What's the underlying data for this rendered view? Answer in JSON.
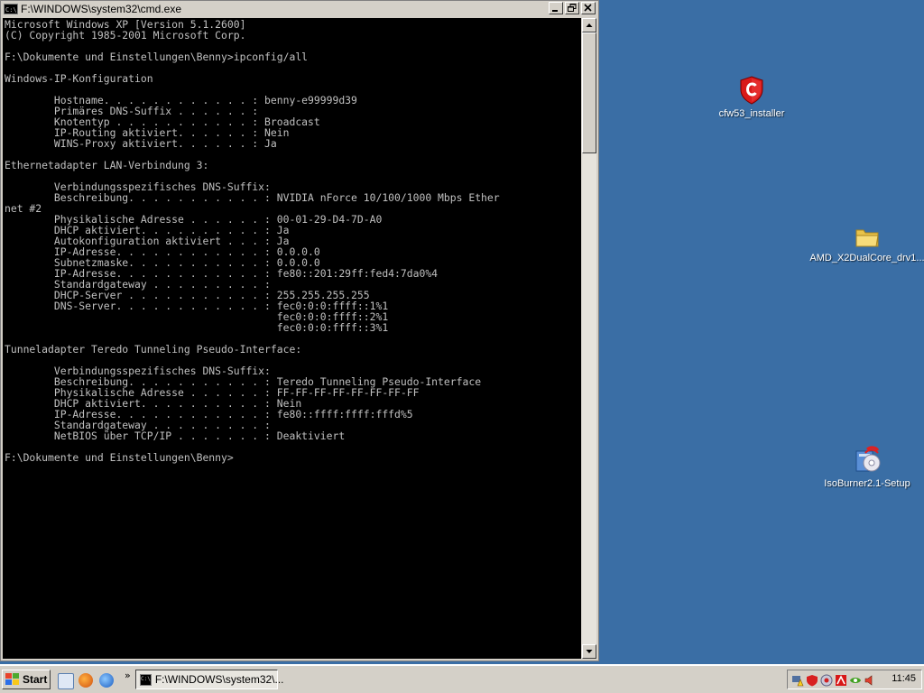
{
  "window": {
    "title": "F:\\WINDOWS\\system32\\cmd.exe",
    "icon_text": "C:\\",
    "buttons": [
      "minimize",
      "restore",
      "close"
    ],
    "console_lines": [
      "Microsoft Windows XP [Version 5.1.2600]",
      "(C) Copyright 1985-2001 Microsoft Corp.",
      "",
      "F:\\Dokumente und Einstellungen\\Benny>ipconfig/all",
      "",
      "Windows-IP-Konfiguration",
      "",
      "        Hostname. . . . . . . . . . . . : benny-e99999d39",
      "        Primäres DNS-Suffix . . . . . . :",
      "        Knotentyp . . . . . . . . . . . : Broadcast",
      "        IP-Routing aktiviert. . . . . . : Nein",
      "        WINS-Proxy aktiviert. . . . . . : Ja",
      "",
      "Ethernetadapter LAN-Verbindung 3:",
      "",
      "        Verbindungsspezifisches DNS-Suffix:",
      "        Beschreibung. . . . . . . . . . . : NVIDIA nForce 10/100/1000 Mbps Ether",
      "net #2",
      "        Physikalische Adresse . . . . . . : 00-01-29-D4-7D-A0",
      "        DHCP aktiviert. . . . . . . . . . : Ja",
      "        Autokonfiguration aktiviert . . . : Ja",
      "        IP-Adresse. . . . . . . . . . . . : 0.0.0.0",
      "        Subnetzmaske. . . . . . . . . . . : 0.0.0.0",
      "        IP-Adresse. . . . . . . . . . . . : fe80::201:29ff:fed4:7da0%4",
      "        Standardgateway . . . . . . . . . :",
      "        DHCP-Server . . . . . . . . . . . : 255.255.255.255",
      "        DNS-Server. . . . . . . . . . . . : fec0:0:0:ffff::1%1",
      "                                            fec0:0:0:ffff::2%1",
      "                                            fec0:0:0:ffff::3%1",
      "",
      "Tunneladapter Teredo Tunneling Pseudo-Interface:",
      "",
      "        Verbindungsspezifisches DNS-Suffix:",
      "        Beschreibung. . . . . . . . . . . : Teredo Tunneling Pseudo-Interface",
      "        Physikalische Adresse . . . . . . : FF-FF-FF-FF-FF-FF-FF-FF",
      "        DHCP aktiviert. . . . . . . . . . : Nein",
      "        IP-Adresse. . . . . . . . . . . . : fe80::ffff:ffff:fffd%5",
      "        Standardgateway . . . . . . . . . :",
      "        NetBIOS über TCP/IP . . . . . . . : Deaktiviert",
      "",
      "F:\\Dokumente und Einstellungen\\Benny>"
    ]
  },
  "desktop": {
    "icons": [
      {
        "label": "cfw53_installer",
        "icon": "shield-c-icon"
      },
      {
        "label": "AMD_X2DualCore_drv1...",
        "icon": "folder-icon"
      },
      {
        "label": "IsoBurner2.1-Setup",
        "icon": "installer-icon"
      }
    ]
  },
  "taskbar": {
    "start_label": "Start",
    "task_label": "F:\\WINDOWS\\system32\\...",
    "task_icon_text": "C:\\",
    "chevron": "»",
    "clock": "11:45"
  },
  "colors": {
    "desktop": "#3a6ea5",
    "console_bg": "#000000",
    "console_fg": "#c0c0c0",
    "chrome": "#d4d0c8"
  }
}
